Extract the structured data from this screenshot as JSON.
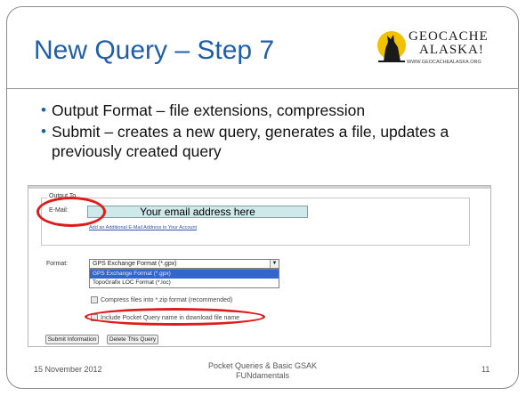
{
  "slide": {
    "title": "New Query – Step 7",
    "bullets": [
      "Output Format – file extensions, compression",
      "Submit – creates a new query, generates a file, updates a previously created query"
    ],
    "bullet_marker": "•",
    "footer": {
      "date": "15 November  2012",
      "center_line1": "Pocket Queries & Basic GSAK",
      "center_line2": "FUNdamentals",
      "page": "11"
    },
    "logo": {
      "name_line1": "GEOCACHE",
      "name_line2": "ALASKA!",
      "url": "WWW.GEOCACHEALASKA.ORG"
    },
    "colors": {
      "title": "#1f5fa8",
      "highlight_oval": "#e01b1b",
      "email_fill": "#cfe9ea"
    }
  },
  "screenshot": {
    "fieldset_label": "Output To",
    "email_label": "E-Mail:",
    "email_value": "Your email address here",
    "add_email_link": "Add an Additional E-Mail Address to Your Account",
    "format_label": "Format:",
    "format_selected": "GPS Exchange Format (*.gpx)",
    "format_options": [
      "GPS Exchange Format (*.gpx)",
      "TopoGrafix LOC Format (*.loc)"
    ],
    "compress_label": "Compress files into *.zip format (recommended)",
    "include_name_label": "Include Pocket Query name in download file name",
    "submit_button": "Submit Information",
    "delete_button": "Delete This Query"
  }
}
